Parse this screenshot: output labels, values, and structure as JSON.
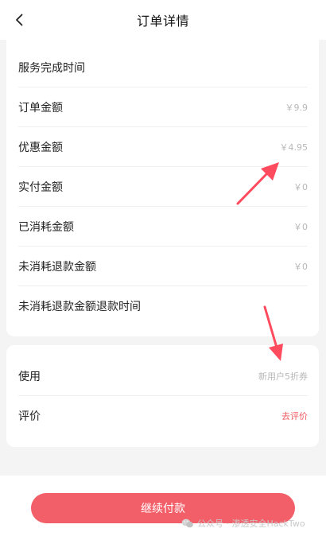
{
  "header": {
    "back_icon": "chevron-left-icon",
    "title": "订单详情"
  },
  "order_info": {
    "rows": [
      {
        "label": "服务完成时间",
        "value": ""
      },
      {
        "label": "订单金额",
        "value": "￥9.9"
      },
      {
        "label": "优惠金额",
        "value": "￥4.95"
      },
      {
        "label": "实付金额",
        "value": "￥0"
      },
      {
        "label": "已消耗金额",
        "value": "￥0"
      },
      {
        "label": "未消耗退款金额",
        "value": "￥0"
      },
      {
        "label": "未消耗退款金额退款时间",
        "value": ""
      }
    ]
  },
  "actions": {
    "use_label": "使用",
    "use_value": "新用户5折券",
    "review_label": "评价",
    "review_link": "去评价"
  },
  "footer": {
    "pay_button": "继续付款"
  },
  "watermark": {
    "text": "公众号 · 渗透安全HackTwo"
  },
  "colors": {
    "accent": "#f35f69",
    "review_link": "#ef5a62",
    "arrow": "#ff4b5e",
    "muted_value": "#b8b8b8"
  }
}
